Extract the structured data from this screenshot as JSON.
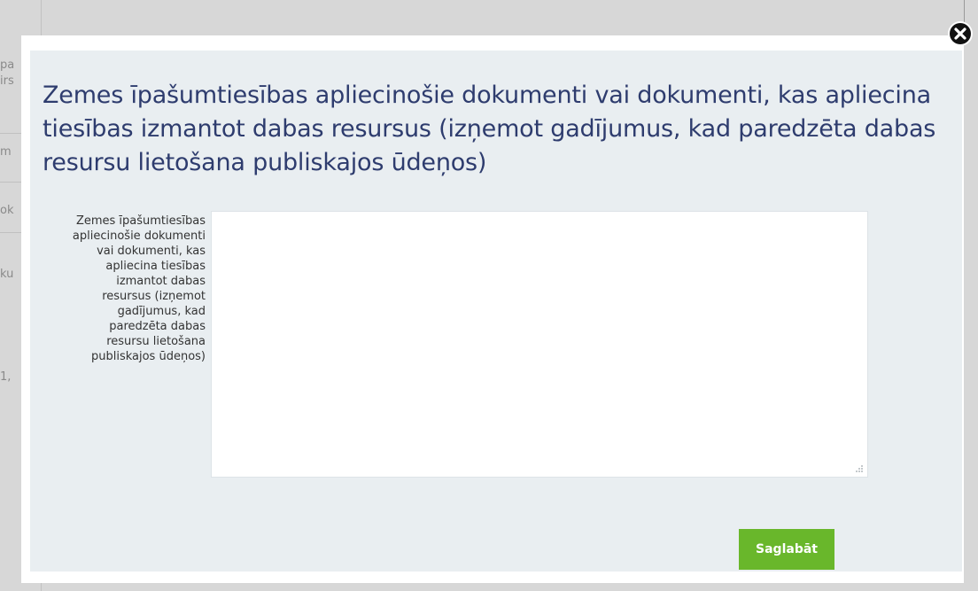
{
  "background": {
    "fragments": [
      "pa",
      "irs",
      "m",
      "ok",
      "ku",
      "1,"
    ]
  },
  "modal": {
    "title": "Zemes īpašumtiesības apliecinošie dokumenti vai dokumenti, kas apliecina tiesības izmantot dabas resursus (izņemot gadījumus, kad paredzēta dabas resursu lietošana publiskajos ūdeņos)",
    "field_label": "Zemes īpašumtiesības apliecinošie dokumenti vai dokumenti, kas apliecina tiesības izmantot dabas resursus (izņemot gadījumus, kad paredzēta dabas resursu lietošana publiskajos ūdeņos)",
    "field_value": "",
    "save_label": "Saglabāt"
  },
  "icons": {
    "close": "close-icon",
    "resize": "resize-grip-icon"
  },
  "colors": {
    "title": "#2e3c6e",
    "save_button": "#69b72b",
    "modal_inner_bg": "#e9eef1"
  }
}
